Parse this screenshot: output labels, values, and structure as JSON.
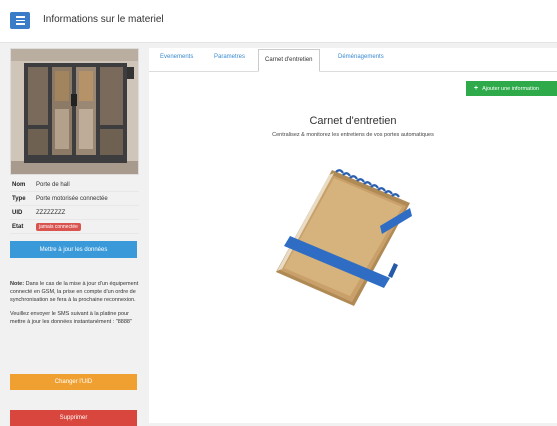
{
  "header": {
    "title": "Informations sur le materiel"
  },
  "sidebar": {
    "info": [
      {
        "key": "Nom",
        "value": "Porte de hall"
      },
      {
        "key": "Type",
        "value": "Porte motorisée connectée"
      },
      {
        "key": "UID",
        "value": "ZZZZZZZZ"
      },
      {
        "key": "Etat",
        "value": "jamais connectée"
      }
    ],
    "update_button": "Mettre à jour les données",
    "note_label": "Note:",
    "note_text": "Dans le cas de la mise à jour d'un équipement connecté en GSM, la prise en compte d'un ordre de synchronisation se fera à la prochaine reconnexion.",
    "note_text2": "Veuillez envoyer le SMS suivant à la platine pour mettre à jour les données instantanément : \"8888\"",
    "change_uid_button": "Changer l'UID",
    "delete_button": "Supprimer"
  },
  "tabs": [
    {
      "label": "Evenements"
    },
    {
      "label": "Parametres"
    },
    {
      "label": "Carnet d'entretien"
    },
    {
      "label": "Déménagements"
    }
  ],
  "content": {
    "add_button": "Ajouter une information",
    "title": "Carnet d'entretien",
    "subtitle": "Centralisez & monitorez les entretiens de vos portes automatiques"
  },
  "colors": {
    "accent": "#3a7cc8",
    "green": "#2eaa4a",
    "orange": "#f0a030",
    "red": "#d9463d"
  }
}
